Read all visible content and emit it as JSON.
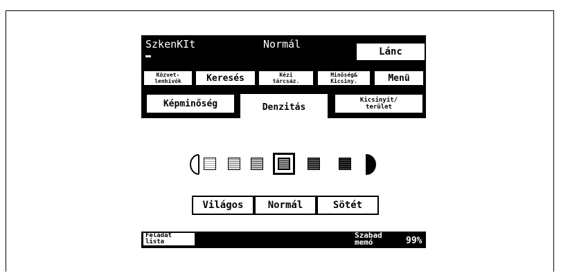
{
  "header": {
    "mode_label": "SzkenKIt",
    "quality_label": "Normál",
    "chain_button": "Lánc"
  },
  "function_buttons": {
    "direct_line1": "Közvet-",
    "direct_line2": "lenhívók",
    "search": "Keresés",
    "manual_line1": "Kézi",
    "manual_line2": "tárcsáz.",
    "quality_line1": "Minőség&",
    "quality_line2": "Kicsiny.",
    "menu": "Menü"
  },
  "tabs": {
    "image_quality": "Képminőség",
    "density": "Denzitás",
    "reduce_line1": "Kicsinyít/",
    "reduce_line2": "terület"
  },
  "density": {
    "levels": 6,
    "selected_level": 3,
    "light_button": "Világos",
    "normal_button": "Normál",
    "dark_button": "Sötét"
  },
  "footer": {
    "job_list_line1": "Feladat",
    "job_list_line2": "lista",
    "free_memory_line1": "Szabad",
    "free_memory_line2": "memó",
    "free_memory_percent": "99%"
  },
  "colors": {
    "screen_bg": "#000000",
    "button_bg": "#ffffff",
    "text": "#000000"
  }
}
